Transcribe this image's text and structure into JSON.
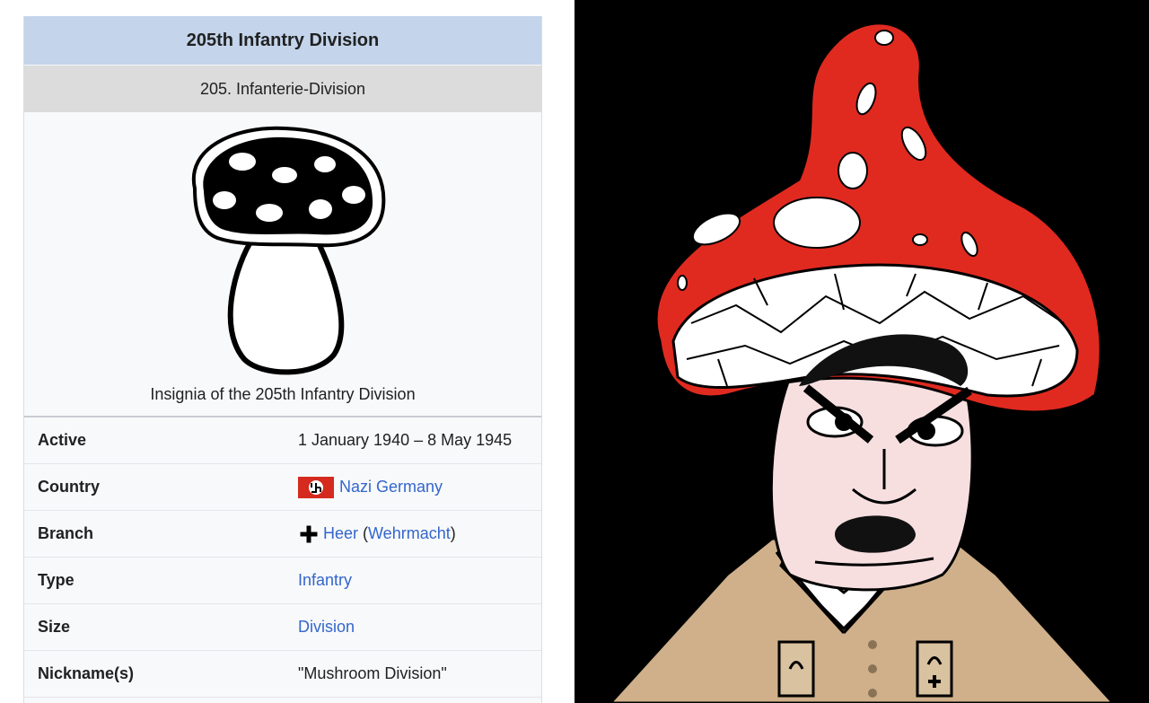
{
  "infobox": {
    "title": "205th Infantry Division",
    "subtitle": "205. Infanterie-Division",
    "caption": "Insignia of the 205th Infantry Division",
    "rows": {
      "active": {
        "label": "Active",
        "value": "1 January 1940 – 8 May 1945"
      },
      "country": {
        "label": "Country",
        "link": "Nazi Germany",
        "icon": "flag-icon"
      },
      "branch": {
        "label": "Branch",
        "link1": "Heer",
        "open": " (",
        "link2": "Wehrmacht",
        "close": ")",
        "icon": "cross-icon"
      },
      "type": {
        "label": "Type",
        "value": "Infantry"
      },
      "size": {
        "label": "Size",
        "value": "Division"
      },
      "nickname": {
        "label": "Nickname(s)",
        "value": "\"Mushroom Division\""
      }
    }
  },
  "illustration": {
    "subject": "mushroom-man-cartoon",
    "colors": {
      "cap": "#e02a20",
      "background": "#000000",
      "uniform": "#d2b48c",
      "skin": "#f7dfe0"
    }
  }
}
